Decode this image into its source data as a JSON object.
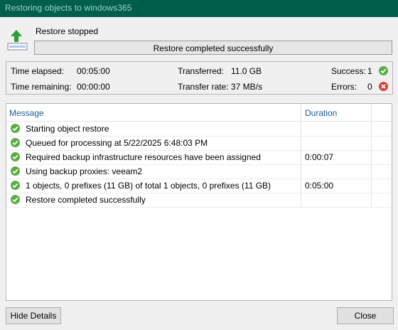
{
  "window": {
    "title": "Restoring objects to windows365"
  },
  "status": {
    "label": "Restore stopped",
    "progress_text": "Restore completed successfully",
    "progress_fraction": 1.0
  },
  "stats": {
    "time_elapsed_label": "Time elapsed:",
    "time_elapsed_value": "00:05:00",
    "time_remaining_label": "Time remaining:",
    "time_remaining_value": "00:00:00",
    "transferred_label": "Transferred:",
    "transferred_value": "11.0 GB",
    "transfer_rate_label": "Transfer rate:",
    "transfer_rate_value": "37 MB/s",
    "success_label": "Success:",
    "success_value": "1",
    "errors_label": "Errors:",
    "errors_value": "0",
    "success_icon": "check-circle-icon",
    "error_icon": "error-circle-icon"
  },
  "log": {
    "columns": {
      "message": "Message",
      "duration": "Duration"
    },
    "rows": [
      {
        "message": "Starting object restore",
        "duration": "",
        "status": "success"
      },
      {
        "message": "Queued for processing at 5/22/2025 6:48:03 PM",
        "duration": "",
        "status": "success"
      },
      {
        "message": "Required backup infrastructure resources have been assigned",
        "duration": "0:00:07",
        "status": "success"
      },
      {
        "message": "Using backup proxies: veeam2",
        "duration": "",
        "status": "success"
      },
      {
        "message": "1 objects, 0 prefixes (11 GB) of total 1 objects, 0 prefixes (11 GB)",
        "duration": "0:05:00",
        "status": "success"
      },
      {
        "message": "Restore completed successfully",
        "duration": "",
        "status": "success"
      }
    ]
  },
  "buttons": {
    "hide_details": "Hide Details",
    "close": "Close"
  },
  "colors": {
    "titlebar": "#005f4b",
    "titlebar_text": "#9fd3c4",
    "success": "#5aac44",
    "error": "#d9413a",
    "header_text": "#1f5a96"
  }
}
